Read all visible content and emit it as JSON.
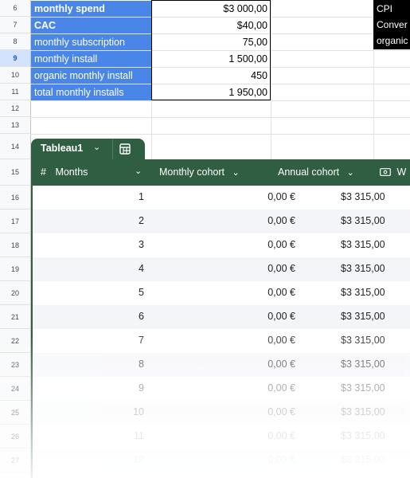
{
  "row_numbers": [
    "6",
    "7",
    "8",
    "9",
    "10",
    "11",
    "12",
    "13",
    "14",
    "15",
    "16",
    "17",
    "18",
    "19",
    "20",
    "21",
    "22",
    "23",
    "24",
    "25",
    "26",
    "27"
  ],
  "selected_row": "9",
  "top_block": [
    {
      "label": "monthly spend",
      "value": "$3 000,00",
      "bold": true
    },
    {
      "label": "CAC",
      "value": "$40,00",
      "bold": true
    },
    {
      "label": "monthly subscription",
      "value": "75,00",
      "bold": false
    },
    {
      "label": "monthly install",
      "value": "1 500,00",
      "bold": false
    },
    {
      "label": "organic monthly install",
      "value": "450",
      "bold": false
    },
    {
      "label": "total monthly installs",
      "value": "1 950,00",
      "bold": false
    }
  ],
  "side_labels": [
    "CPI",
    "Conver",
    "organic"
  ],
  "table": {
    "name": "Tableau1",
    "columns": {
      "months": "Months",
      "monthly": "Monthly cohort",
      "annual": "Annual cohort",
      "w": "W"
    },
    "rows": [
      {
        "months": "1",
        "monthly": "0,00 €",
        "annual": "$3 315,00"
      },
      {
        "months": "2",
        "monthly": "0,00 €",
        "annual": "$3 315,00"
      },
      {
        "months": "3",
        "monthly": "0,00 €",
        "annual": "$3 315,00"
      },
      {
        "months": "4",
        "monthly": "0,00 €",
        "annual": "$3 315,00"
      },
      {
        "months": "5",
        "monthly": "0,00 €",
        "annual": "$3 315,00"
      },
      {
        "months": "6",
        "monthly": "0,00 €",
        "annual": "$3 315,00"
      },
      {
        "months": "7",
        "monthly": "0,00 €",
        "annual": "$3 315,00"
      },
      {
        "months": "8",
        "monthly": "0,00 €",
        "annual": "$3 315,00"
      },
      {
        "months": "9",
        "monthly": "0,00 €",
        "annual": "$3 315,00"
      },
      {
        "months": "10",
        "monthly": "0,00 €",
        "annual": "$3 315,00"
      },
      {
        "months": "11",
        "monthly": "0,00 €",
        "annual": "$3 315,00"
      },
      {
        "months": "12",
        "monthly": "0,00 €",
        "annual": "$3 315,00"
      }
    ]
  },
  "colors": {
    "label_bg": "#4a86e8",
    "table_header": "#2f5e43",
    "side_box": "#000000"
  }
}
